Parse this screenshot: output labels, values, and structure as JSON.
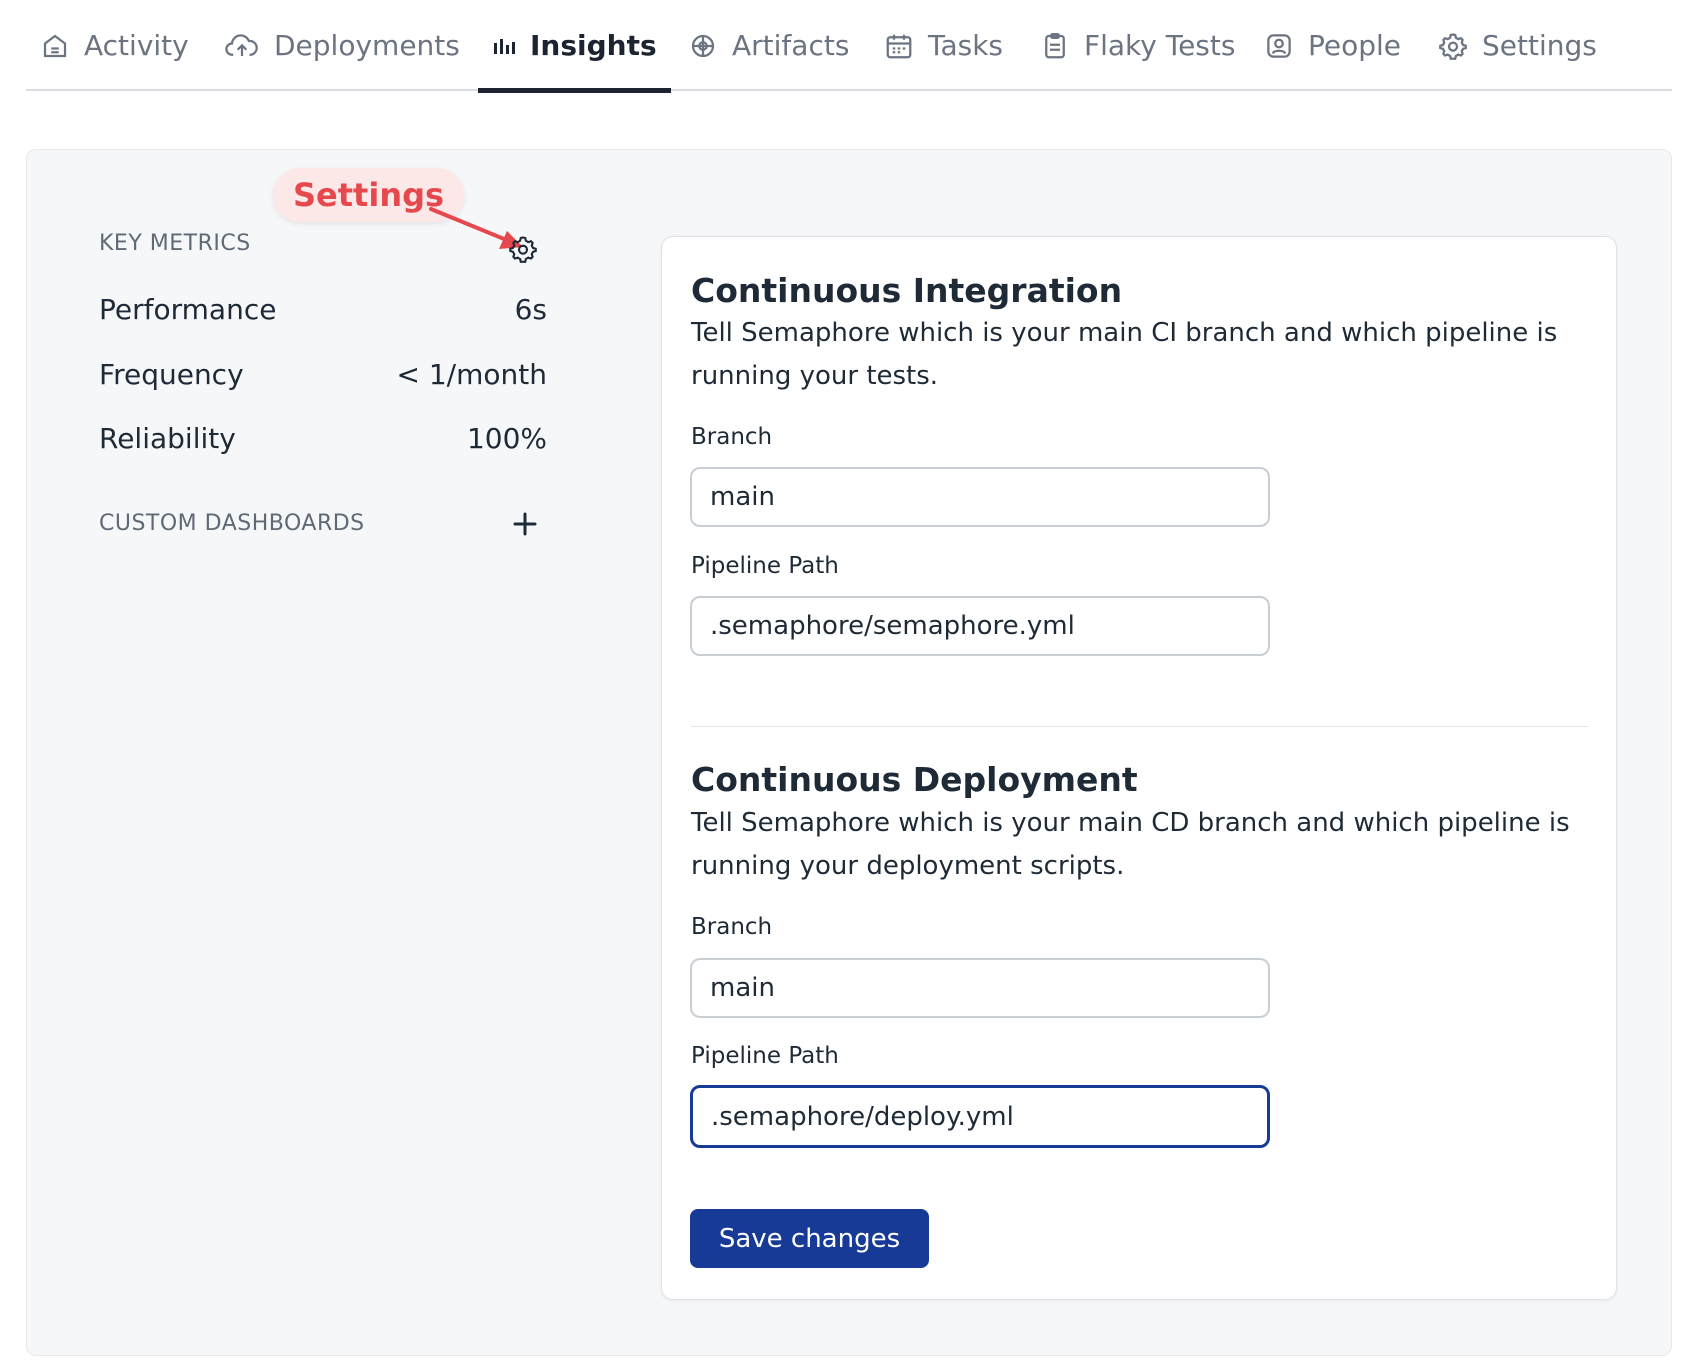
{
  "tabs": [
    {
      "label": "Activity",
      "icon": "home-icon",
      "active": false
    },
    {
      "label": "Deployments",
      "icon": "cloud-upload-icon",
      "active": false
    },
    {
      "label": "Insights",
      "icon": "bar-chart-icon",
      "active": true
    },
    {
      "label": "Artifacts",
      "icon": "artifact-icon",
      "active": false
    },
    {
      "label": "Tasks",
      "icon": "calendar-icon",
      "active": false
    },
    {
      "label": "Flaky Tests",
      "icon": "clipboard-icon",
      "active": false
    },
    {
      "label": "People",
      "icon": "user-icon",
      "active": false
    },
    {
      "label": "Settings",
      "icon": "gear-icon",
      "active": false
    }
  ],
  "callout": {
    "label": "Settings",
    "color": "#e5484d"
  },
  "key_metrics": {
    "heading": "KEY METRICS",
    "rows": [
      {
        "label": "Performance",
        "value": "6s"
      },
      {
        "label": "Frequency",
        "value": "< 1/month"
      },
      {
        "label": "Reliability",
        "value": "100%"
      }
    ]
  },
  "custom_dashboards": {
    "heading": "CUSTOM DASHBOARDS",
    "add_icon": "plus-icon"
  },
  "ci": {
    "title": "Continuous Integration",
    "description": "Tell Semaphore which is your main CI branch and which pipeline is running your tests.",
    "branch_label": "Branch",
    "branch_value": "main",
    "pipeline_label": "Pipeline Path",
    "pipeline_value": ".semaphore/semaphore.yml"
  },
  "cd": {
    "title": "Continuous Deployment",
    "description": "Tell Semaphore which is your main CD branch and which pipeline is running your deployment scripts.",
    "branch_label": "Branch",
    "branch_value": "main",
    "pipeline_label": "Pipeline Path",
    "pipeline_value": ".semaphore/deploy.yml"
  },
  "save_label": "Save changes",
  "colors": {
    "accent": "#163a96",
    "callout": "#e5484d"
  }
}
